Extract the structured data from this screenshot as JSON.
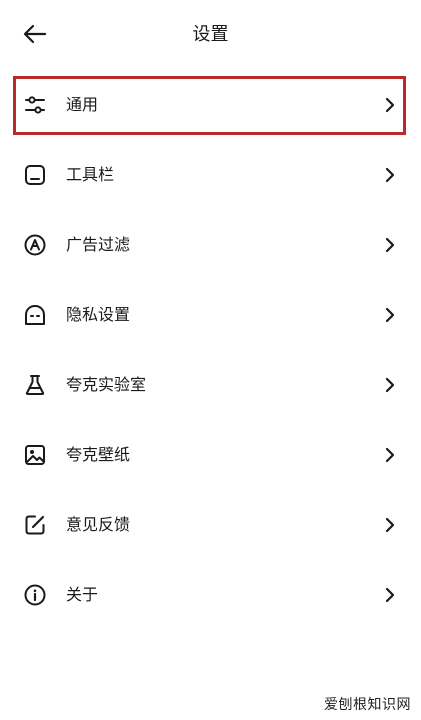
{
  "header": {
    "title": "设置",
    "back_icon": "arrow-left-icon"
  },
  "menu": {
    "items": [
      {
        "label": "通用",
        "icon": "sliders-icon",
        "highlighted": true
      },
      {
        "label": "工具栏",
        "icon": "toolbar-icon"
      },
      {
        "label": "广告过滤",
        "icon": "ad-block-icon"
      },
      {
        "label": "隐私设置",
        "icon": "privacy-icon"
      },
      {
        "label": "夸克实验室",
        "icon": "flask-icon"
      },
      {
        "label": "夸克壁纸",
        "icon": "wallpaper-icon"
      },
      {
        "label": "意见反馈",
        "icon": "feedback-icon"
      },
      {
        "label": "关于",
        "icon": "info-icon"
      }
    ]
  },
  "colors": {
    "highlight_border": "#b92a28",
    "text": "#1a1a1a"
  },
  "watermark": {
    "text": "爱刨根知识网"
  }
}
